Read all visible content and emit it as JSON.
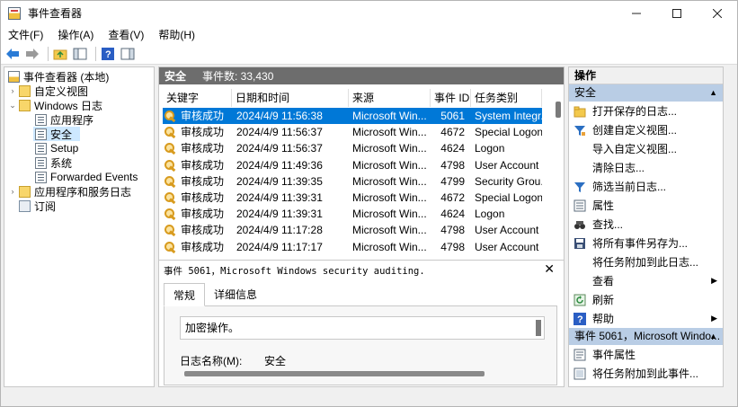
{
  "window": {
    "title": "事件查看器"
  },
  "menu": [
    "文件(F)",
    "操作(A)",
    "查看(V)",
    "帮助(H)"
  ],
  "tree": [
    {
      "label": "事件查看器 (本地)",
      "icon": "event-viewer-icon",
      "level": 0,
      "expander": ""
    },
    {
      "label": "自定义视图",
      "icon": "folder-icon",
      "level": 1,
      "expander": "›"
    },
    {
      "label": "Windows 日志",
      "icon": "folder-icon",
      "level": 1,
      "expander": "⌄"
    },
    {
      "label": "应用程序",
      "icon": "log-icon",
      "level": 2,
      "expander": ""
    },
    {
      "label": "安全",
      "icon": "log-icon",
      "level": 2,
      "expander": "",
      "selected": true
    },
    {
      "label": "Setup",
      "icon": "log-icon",
      "level": 2,
      "expander": ""
    },
    {
      "label": "系统",
      "icon": "log-icon",
      "level": 2,
      "expander": ""
    },
    {
      "label": "Forwarded Events",
      "icon": "log-icon",
      "level": 2,
      "expander": ""
    },
    {
      "label": "应用程序和服务日志",
      "icon": "folder-icon",
      "level": 1,
      "expander": "›"
    },
    {
      "label": "订阅",
      "icon": "subscription-icon",
      "level": 1,
      "expander": ""
    }
  ],
  "center": {
    "log_name": "安全",
    "event_count": "事件数: 33,430",
    "columns": [
      "关键字",
      "日期和时间",
      "来源",
      "事件 ID",
      "任务类别"
    ],
    "rows": [
      {
        "keyword": "审核成功",
        "datetime": "2024/4/9 11:56:38",
        "source": "Microsoft Win...",
        "id": "5061",
        "category": "System Integr...",
        "selected": true
      },
      {
        "keyword": "审核成功",
        "datetime": "2024/4/9 11:56:37",
        "source": "Microsoft Win...",
        "id": "4672",
        "category": "Special Logon"
      },
      {
        "keyword": "审核成功",
        "datetime": "2024/4/9 11:56:37",
        "source": "Microsoft Win...",
        "id": "4624",
        "category": "Logon"
      },
      {
        "keyword": "审核成功",
        "datetime": "2024/4/9 11:49:36",
        "source": "Microsoft Win...",
        "id": "4798",
        "category": "User Account ..."
      },
      {
        "keyword": "审核成功",
        "datetime": "2024/4/9 11:39:35",
        "source": "Microsoft Win...",
        "id": "4799",
        "category": "Security Grou..."
      },
      {
        "keyword": "审核成功",
        "datetime": "2024/4/9 11:39:31",
        "source": "Microsoft Win...",
        "id": "4672",
        "category": "Special Logon"
      },
      {
        "keyword": "审核成功",
        "datetime": "2024/4/9 11:39:31",
        "source": "Microsoft Win...",
        "id": "4624",
        "category": "Logon"
      },
      {
        "keyword": "审核成功",
        "datetime": "2024/4/9 11:17:28",
        "source": "Microsoft Win...",
        "id": "4798",
        "category": "User Account ..."
      },
      {
        "keyword": "审核成功",
        "datetime": "2024/4/9 11:17:17",
        "source": "Microsoft Win...",
        "id": "4798",
        "category": "User Account ..."
      }
    ],
    "detail": {
      "title": "事件 5061，Microsoft Windows security auditing.",
      "tabs": [
        "常规",
        "详细信息"
      ],
      "description": "加密操作。",
      "log_name_label": "日志名称(M):",
      "log_name_value": "安全"
    }
  },
  "actions": {
    "title": "操作",
    "group1": "安全",
    "items1": [
      {
        "label": "打开保存的日志...",
        "icon": "open-folder-icon"
      },
      {
        "label": "创建自定义视图...",
        "icon": "filter-create-icon"
      },
      {
        "label": "导入自定义视图...",
        "icon": ""
      },
      {
        "label": "清除日志...",
        "icon": ""
      },
      {
        "label": "筛选当前日志...",
        "icon": "filter-icon"
      },
      {
        "label": "属性",
        "icon": "properties-icon"
      },
      {
        "label": "查找...",
        "icon": "find-icon"
      },
      {
        "label": "将所有事件另存为...",
        "icon": "save-icon"
      },
      {
        "label": "将任务附加到此日志...",
        "icon": ""
      },
      {
        "label": "查看",
        "icon": "",
        "submenu": true
      },
      {
        "label": "刷新",
        "icon": "refresh-icon"
      },
      {
        "label": "帮助",
        "icon": "help-icon",
        "submenu": true
      }
    ],
    "group2": "事件 5061，Microsoft Windo...",
    "items2": [
      {
        "label": "事件属性",
        "icon": "event-properties-icon"
      },
      {
        "label": "将任务附加到此事件...",
        "icon": "attach-task-icon"
      }
    ]
  },
  "colors": {
    "selection": "#0078d7",
    "tree_selection": "#cde8ff",
    "group_header": "#b9cde5",
    "header_bar": "#6d6d6d"
  }
}
